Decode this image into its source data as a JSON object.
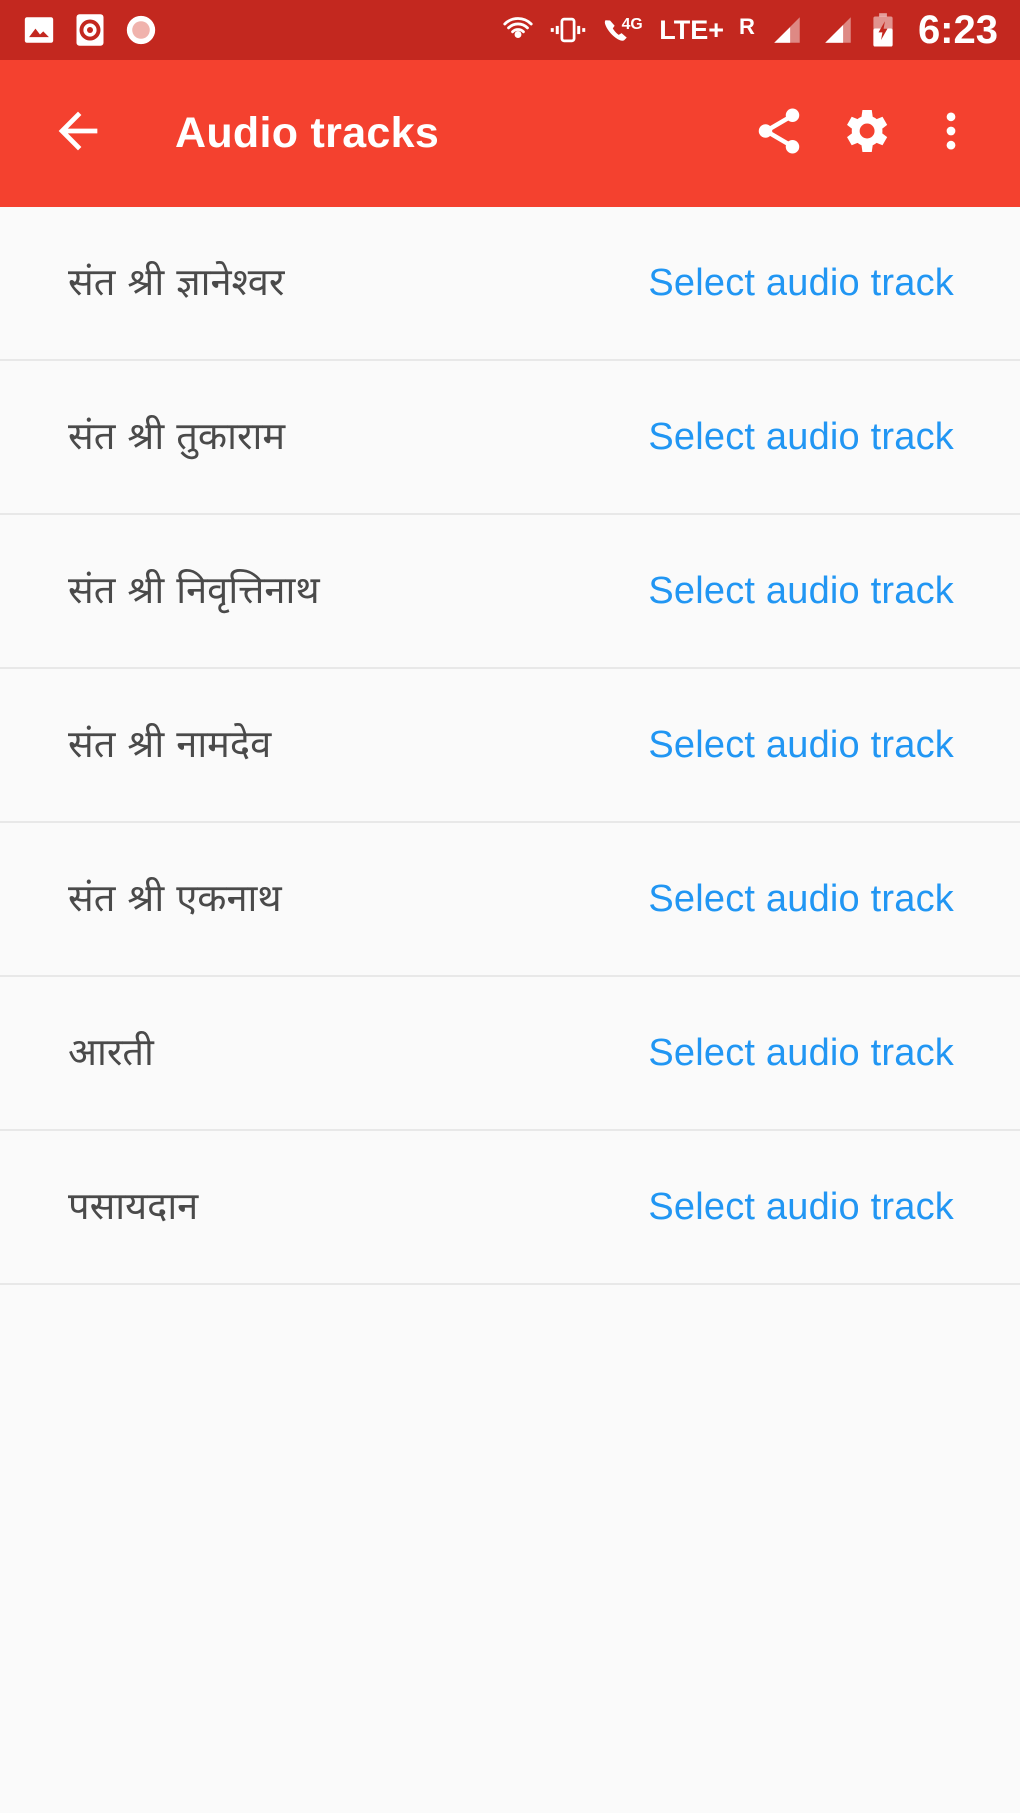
{
  "status_bar": {
    "background_color": "#c3281f",
    "left_icons": [
      "image-icon",
      "screen-recorder-icon",
      "record-dot-icon"
    ],
    "right_icons": [
      "hotspot-icon",
      "vibrate-icon",
      "call-4g-icon",
      "signal-bar-icon-1",
      "signal-bar-icon-2",
      "battery-charging-icon"
    ],
    "network_label": "LTE+",
    "roaming_label": "R",
    "data_label": "4G",
    "clock": "6:23"
  },
  "app_bar": {
    "background_color": "#f4412f",
    "title": "Audio tracks",
    "back_icon": "arrow-back-icon",
    "actions": [
      {
        "name": "share",
        "icon": "share-icon"
      },
      {
        "name": "settings",
        "icon": "gear-icon"
      },
      {
        "name": "overflow",
        "icon": "more-vert-icon"
      }
    ]
  },
  "list": {
    "action_color": "#2196f3",
    "rows": [
      {
        "title": "संत श्री ज्ञानेश्वर",
        "action": "Select audio track"
      },
      {
        "title": "संत श्री तुकाराम",
        "action": "Select audio track"
      },
      {
        "title": "संत श्री निवृत्तिनाथ",
        "action": "Select audio track"
      },
      {
        "title": "संत श्री नामदेव",
        "action": "Select audio track"
      },
      {
        "title": "संत श्री एकनाथ",
        "action": "Select audio track"
      },
      {
        "title": "आरती",
        "action": "Select audio track"
      },
      {
        "title": "पसायदान",
        "action": "Select audio track"
      }
    ]
  }
}
